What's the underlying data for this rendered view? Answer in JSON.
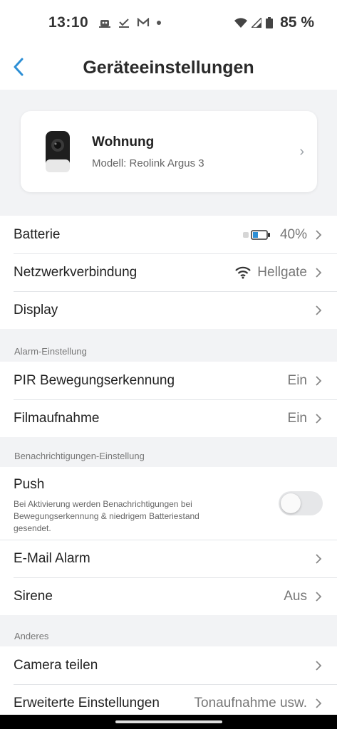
{
  "status": {
    "time": "13:10",
    "battery": "85 %"
  },
  "header": {
    "title": "Geräteeinstellungen"
  },
  "device": {
    "name": "Wohnung",
    "model": "Modell:  Reolink Argus 3"
  },
  "main": [
    {
      "label": "Batterie",
      "value": "40%"
    },
    {
      "label": "Netzwerkverbindung",
      "value": "Hellgate"
    },
    {
      "label": "Display",
      "value": ""
    }
  ],
  "alarm": {
    "title": "Alarm-Einstellung",
    "rows": [
      {
        "label": "PIR Bewegungserkennung",
        "value": "Ein"
      },
      {
        "label": "Filmaufnahme",
        "value": "Ein"
      }
    ]
  },
  "notify": {
    "title": "Benachrichtigungen-Einstellung",
    "push_label": "Push",
    "push_desc": "Bei Aktivierung werden Benachrichtigungen bei Bewegungserkennung & niedrigem Batteriestand gesendet.",
    "push_enabled": false,
    "rows": [
      {
        "label": "E-Mail Alarm",
        "value": ""
      },
      {
        "label": "Sirene",
        "value": "Aus"
      }
    ]
  },
  "other": {
    "title": "Anderes",
    "rows": [
      {
        "label": "Camera teilen",
        "value": ""
      },
      {
        "label": "Erweiterte Einstellungen",
        "value": "Tonaufnahme usw."
      }
    ]
  },
  "colors": {
    "accent": "#2d8fd5",
    "battery_fill": "#2d8fd5"
  }
}
